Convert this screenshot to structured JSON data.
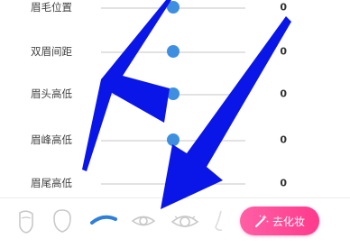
{
  "sliders": [
    {
      "label": "眉毛位置",
      "value": "0",
      "level": 0.5
    },
    {
      "label": "双眉间距",
      "value": "0",
      "level": 0.5
    },
    {
      "label": "眉头高低",
      "value": "0",
      "level": 0.5
    },
    {
      "label": "眉峰高低",
      "value": "0",
      "level": 0.5
    },
    {
      "label": "眉尾高低",
      "value": "0",
      "level": 0.5
    }
  ],
  "toolbar": {
    "tools": [
      "face-outline-icon",
      "face-shape-icon",
      "eyebrow-icon",
      "eye-icon",
      "eye-large-icon",
      "nose-icon"
    ],
    "active_tool": "eyebrow-icon",
    "makeup_button_label": "去化妆"
  },
  "colors": {
    "slider_thumb": "#3f8fe0",
    "annotation_arrow": "#0a16e8",
    "makeup_button": "#ff4496"
  }
}
